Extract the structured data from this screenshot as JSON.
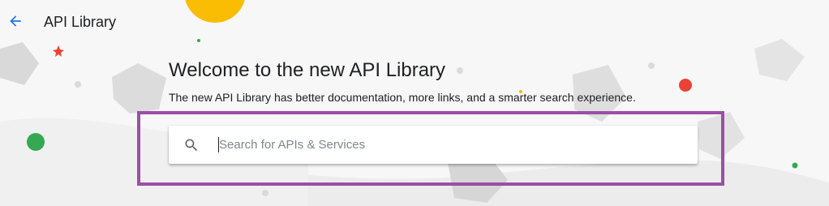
{
  "header": {
    "title": "API Library",
    "back_icon": "arrow-back-icon"
  },
  "hero": {
    "title": "Welcome to the new API Library",
    "subtitle": "The new API Library has better documentation, more links, and a smarter search experience."
  },
  "search": {
    "placeholder": "Search for APIs & Services",
    "value": "",
    "icon": "search-icon"
  },
  "colors": {
    "accent_blue": "#1a73e8",
    "highlight_purple": "#9a4fa6",
    "yellow_decor": "#fbbc04",
    "red_decor": "#ea4335",
    "green_decor": "#34a853"
  }
}
